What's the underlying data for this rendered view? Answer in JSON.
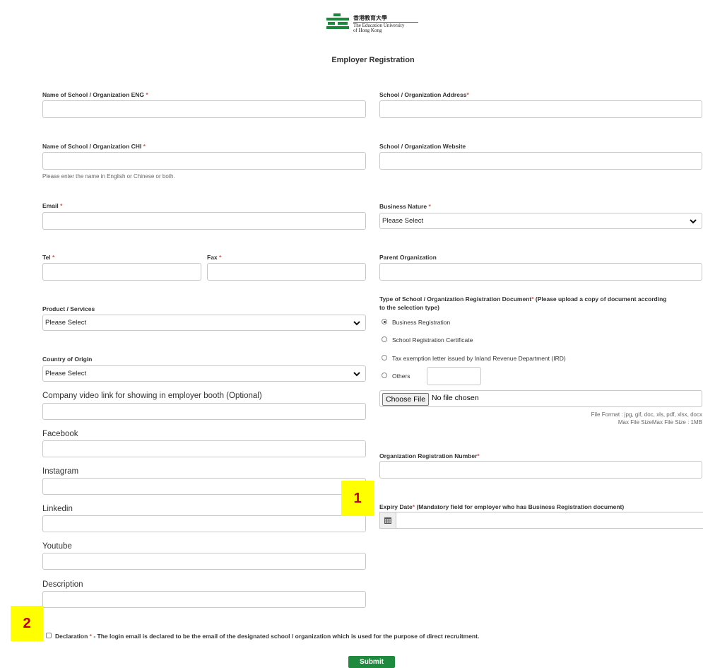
{
  "logo": {
    "chinese": "香港教育大學",
    "english_line1": "The Education University",
    "english_line2": "of Hong Kong",
    "color": "#1a8a3a"
  },
  "page_title": "Employer Registration",
  "fields": {
    "name_eng": {
      "label": "Name of School / Organization ENG",
      "required": "*"
    },
    "name_chi": {
      "label": "Name of School / Organization CHI",
      "required": "*",
      "hint": "Please enter the name in English or Chinese or both."
    },
    "email": {
      "label": "Email",
      "required": "*"
    },
    "tel": {
      "label": "Tel",
      "required": "*"
    },
    "fax": {
      "label": "Fax",
      "required": "*"
    },
    "product_services": {
      "label": "Product / Services",
      "value": "Please Select"
    },
    "country": {
      "label": "Country of Origin",
      "value": "Please Select"
    },
    "video_link": {
      "label": "Company video link for showing in employer booth (Optional)"
    },
    "facebook": {
      "label": "Facebook"
    },
    "instagram": {
      "label": "Instagram"
    },
    "linkedin": {
      "label": "Linkedin"
    },
    "youtube": {
      "label": "Youtube"
    },
    "description": {
      "label": "Description"
    },
    "address": {
      "label": "School / Organization Address",
      "required": "*"
    },
    "website": {
      "label": "School / Organization Website"
    },
    "business_nature": {
      "label": "Business Nature",
      "required": "*",
      "value": "Please Select"
    },
    "parent_org": {
      "label": "Parent Organization"
    },
    "reg_doc_type": {
      "label_a": "Type of School / Organization Registration Document",
      "required": "*",
      "label_b": " (Please upload a copy of document according",
      "label_c": "to the selection type)",
      "options": [
        "Business Registration",
        "School Registration Certificate",
        "Tax exemption letter issued by Inland Revenue Department (IRD)",
        "Others"
      ],
      "selected": "Business Registration"
    },
    "file_upload": {
      "button": "Choose File",
      "status": "No file chosen",
      "format_note": "File Format : jpg, gif, doc, xls, pdf, xlsx, docx",
      "size_note": "Max File SizeMax File Size : 1MB"
    },
    "reg_number": {
      "label": "Organization Registration Number",
      "required": "*"
    },
    "expiry_date": {
      "label": "Expiry Date",
      "required": "*",
      "note": " (Mandatory field for employer who has Business Registration document)"
    }
  },
  "declaration": {
    "label": "Declaration",
    "required": "*",
    "text": " - The login email is declared to be the email of the designated school / organization which is used for the purpose of direct recruitment."
  },
  "submit_label": "Submit",
  "annotations": {
    "badge1": "1",
    "badge2": "2"
  },
  "colors": {
    "submit": "#1e8a3e",
    "required": "#d9534f",
    "badge_bg": "#ffff00",
    "badge_text": "#c00000"
  }
}
